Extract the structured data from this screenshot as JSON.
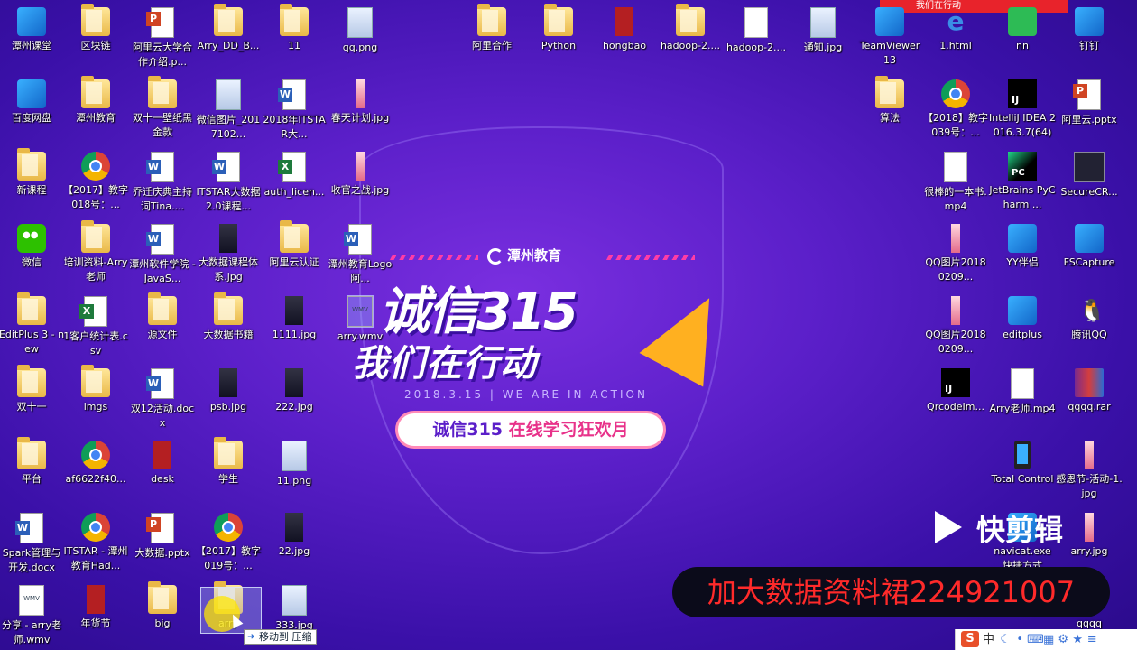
{
  "desktop": {
    "icons": [
      {
        "label": "潭州课堂",
        "type": "app"
      },
      {
        "label": "区块链",
        "type": "folder"
      },
      {
        "label": "阿里云大学合作介绍.p...",
        "type": "ppt"
      },
      {
        "label": "Arry_DD_B...",
        "type": "folder"
      },
      {
        "label": "11",
        "type": "folder"
      },
      {
        "label": "qq.png",
        "type": "img"
      },
      {
        "label": "阿里合作",
        "type": "folder"
      },
      {
        "label": "Python",
        "type": "folder"
      },
      {
        "label": "hongbao",
        "type": "hb"
      },
      {
        "label": "hadoop-2....",
        "type": "folder"
      },
      {
        "label": "hadoop-2....",
        "type": "file"
      },
      {
        "label": "通知.jpg",
        "type": "img"
      },
      {
        "label": "TeamViewer 13",
        "type": "app"
      },
      {
        "label": "1.html",
        "type": "ie"
      },
      {
        "label": "nn",
        "type": "green"
      },
      {
        "label": "钉钉",
        "type": "app"
      },
      {
        "label": "百度网盘",
        "type": "app"
      },
      {
        "label": "潭州教育",
        "type": "folder"
      },
      {
        "label": "双十一壁纸黑金款",
        "type": "folder"
      },
      {
        "label": "微信图片_2017102...",
        "type": "img"
      },
      {
        "label": "2018年ITSTAR大...",
        "type": "doc"
      },
      {
        "label": "春天计划.jpg",
        "type": "imgpink"
      },
      {
        "label": "算法",
        "type": "folder"
      },
      {
        "label": "【2018】教字039号：...",
        "type": "chrome"
      },
      {
        "label": "IntelliJ IDEA 2016.3.7(64)",
        "type": "jb"
      },
      {
        "label": "阿里云.pptx",
        "type": "ppt"
      },
      {
        "label": "新课程",
        "type": "folder"
      },
      {
        "label": "【2017】教字018号：...",
        "type": "chrome"
      },
      {
        "label": "乔迁庆典主持词Tina....",
        "type": "doc"
      },
      {
        "label": "ITSTAR大数据2.0课程...",
        "type": "doc"
      },
      {
        "label": "auth_licen...",
        "type": "xls"
      },
      {
        "label": "收官之战.jpg",
        "type": "imgpink"
      },
      {
        "label": "很棒的一本书.mp4",
        "type": "file"
      },
      {
        "label": "JetBrains PyCharm ...",
        "type": "pc"
      },
      {
        "label": "SecureCR...",
        "type": "term"
      },
      {
        "label": "微信",
        "type": "wechat"
      },
      {
        "label": "培训资料-Arry老师",
        "type": "folder"
      },
      {
        "label": "潭州软件学院 - JavaS...",
        "type": "doc"
      },
      {
        "label": "大数据课程体系.jpg",
        "type": "imgdark"
      },
      {
        "label": "阿里云认证",
        "type": "folder"
      },
      {
        "label": "潭州教育Logo 阿...",
        "type": "doc"
      },
      {
        "label": "QQ图片20180209...",
        "type": "imgpink"
      },
      {
        "label": "YY伴侣",
        "type": "app"
      },
      {
        "label": "FSCapture",
        "type": "app"
      },
      {
        "label": "EditPlus 3 - new",
        "type": "folder"
      },
      {
        "label": "1客户统计表.csv",
        "type": "xls"
      },
      {
        "label": "源文件",
        "type": "folder"
      },
      {
        "label": "大数据书籍",
        "type": "folder"
      },
      {
        "label": "1111.jpg",
        "type": "imgdark"
      },
      {
        "label": "arry.wmv",
        "type": "video"
      },
      {
        "label": "QQ图片20180209...",
        "type": "imgpink"
      },
      {
        "label": "editplus",
        "type": "app"
      },
      {
        "label": "腾讯QQ",
        "type": "qq"
      },
      {
        "label": "双十一",
        "type": "folder"
      },
      {
        "label": "imgs",
        "type": "folder"
      },
      {
        "label": "双12活动.docx",
        "type": "doc"
      },
      {
        "label": "psb.jpg",
        "type": "imgdark"
      },
      {
        "label": "222.jpg",
        "type": "imgdark"
      },
      {
        "label": "QrcodeIm...",
        "type": "jb"
      },
      {
        "label": "Arry老师.mp4",
        "type": "file"
      },
      {
        "label": "qqqq.rar",
        "type": "rar"
      },
      {
        "label": "平台",
        "type": "folder"
      },
      {
        "label": "af6622f40...",
        "type": "chrome"
      },
      {
        "label": "desk",
        "type": "hb"
      },
      {
        "label": "学生",
        "type": "folder"
      },
      {
        "label": "11.png",
        "type": "img"
      },
      {
        "label": "Total Control",
        "type": "phone"
      },
      {
        "label": "感恩节-活动-1.jpg",
        "type": "imgpink"
      },
      {
        "label": "Spark管理与开发.docx",
        "type": "doc"
      },
      {
        "label": "ITSTAR - 潭州教育Had...",
        "type": "chrome"
      },
      {
        "label": "大数据.pptx",
        "type": "ppt"
      },
      {
        "label": "【2017】教字019号：...",
        "type": "chrome"
      },
      {
        "label": "22.jpg",
        "type": "imgdark"
      },
      {
        "label": "navicat.exe 快捷方式",
        "type": "app"
      },
      {
        "label": "arry.jpg",
        "type": "imgpink"
      },
      {
        "label": "分享 - arry老师.wmv",
        "type": "video"
      },
      {
        "label": "年货节",
        "type": "hb"
      },
      {
        "label": "big",
        "type": "folder"
      },
      {
        "label": "arry",
        "type": "folder"
      },
      {
        "label": "333.jpg",
        "type": "img"
      },
      {
        "label": "qqqq",
        "type": "sec"
      }
    ]
  },
  "wallpaper": {
    "brand": "潭州教育",
    "headline": "诚信315",
    "subline": "我们在行动",
    "date_text": "2018.3.15 | WE ARE IN ACTION",
    "pill_main": "诚信315",
    "pill_highlight": "在线学习狂欢月"
  },
  "top_app_label": "我们在行动",
  "watermark": "快剪辑",
  "promo_text": "加大数据资料裙224921007",
  "drag_tooltip": "移动到 压缩",
  "ime": {
    "logo": "S",
    "mode": "中",
    "glyphs": [
      "☾",
      "•",
      "⌨",
      "▦",
      "⚙",
      "★",
      "≡"
    ]
  },
  "colors": {
    "wallpaper": "#5b1fc9",
    "promo_text": "#ff2a2a",
    "pill_highlight": "#e8328a"
  }
}
